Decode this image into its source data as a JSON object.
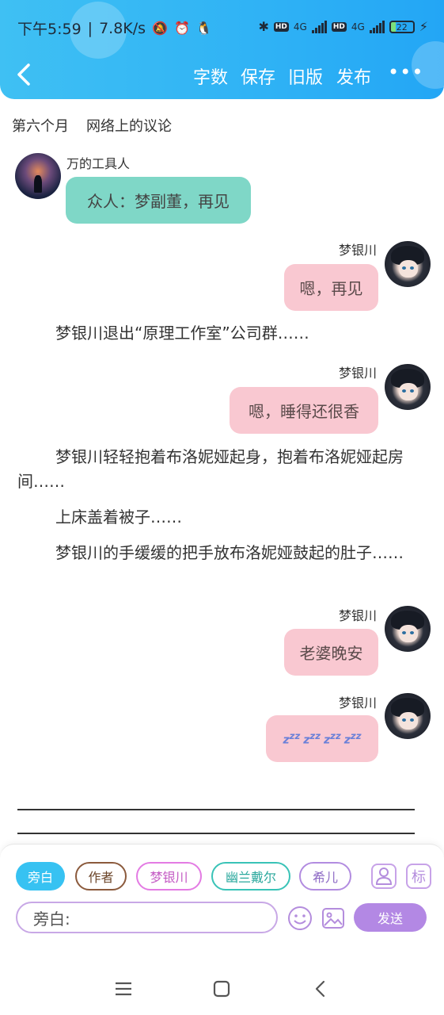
{
  "status_bar": {
    "time": "下午5:59",
    "speed": "7.8K/s",
    "separator": "|",
    "hd1": "HD",
    "net1": "4G",
    "hd2": "HD",
    "net2": "4G",
    "battery": "22"
  },
  "toolbar": {
    "word_count": "字数",
    "save": "保存",
    "old_version": "旧版",
    "publish": "发布"
  },
  "chapter": {
    "month": "第六个月",
    "title": "网络上的议论"
  },
  "messages": [
    {
      "sender": "万的工具人",
      "text": "众人：梦副董，再见",
      "side": "left"
    },
    {
      "sender": "梦银川",
      "text": "嗯，再见",
      "side": "right"
    },
    {
      "narration": "梦银川退出“原理工作室”公司群……"
    },
    {
      "sender": "梦银川",
      "text": "嗯，睡得还很香",
      "side": "right"
    },
    {
      "narration": "梦银川轻轻抱着布洛妮娅起身，抱着布洛妮娅起房间……"
    },
    {
      "narration": "上床盖着被子……"
    },
    {
      "narration": "梦银川的手缓缓的把手放布洛妮娅鼓起的肚子……"
    },
    {
      "sender": "梦银川",
      "text": "老婆晚安",
      "side": "right"
    },
    {
      "sender": "梦银川",
      "text": "zzz zzz zzz zzz",
      "side": "right"
    }
  ],
  "editor": {
    "roles": [
      "旁白",
      "作者",
      "梦银川",
      "幽兰戴尔",
      "希儿"
    ],
    "active_role": "旁白",
    "mark_label": "标",
    "input_value": "旁白:",
    "send_label": "发送"
  },
  "colors": {
    "header": "#2fb2f5",
    "teal_bubble": "#7fd7c7",
    "pink_bubble": "#f9c8d1",
    "send_button": "#b388e4"
  }
}
